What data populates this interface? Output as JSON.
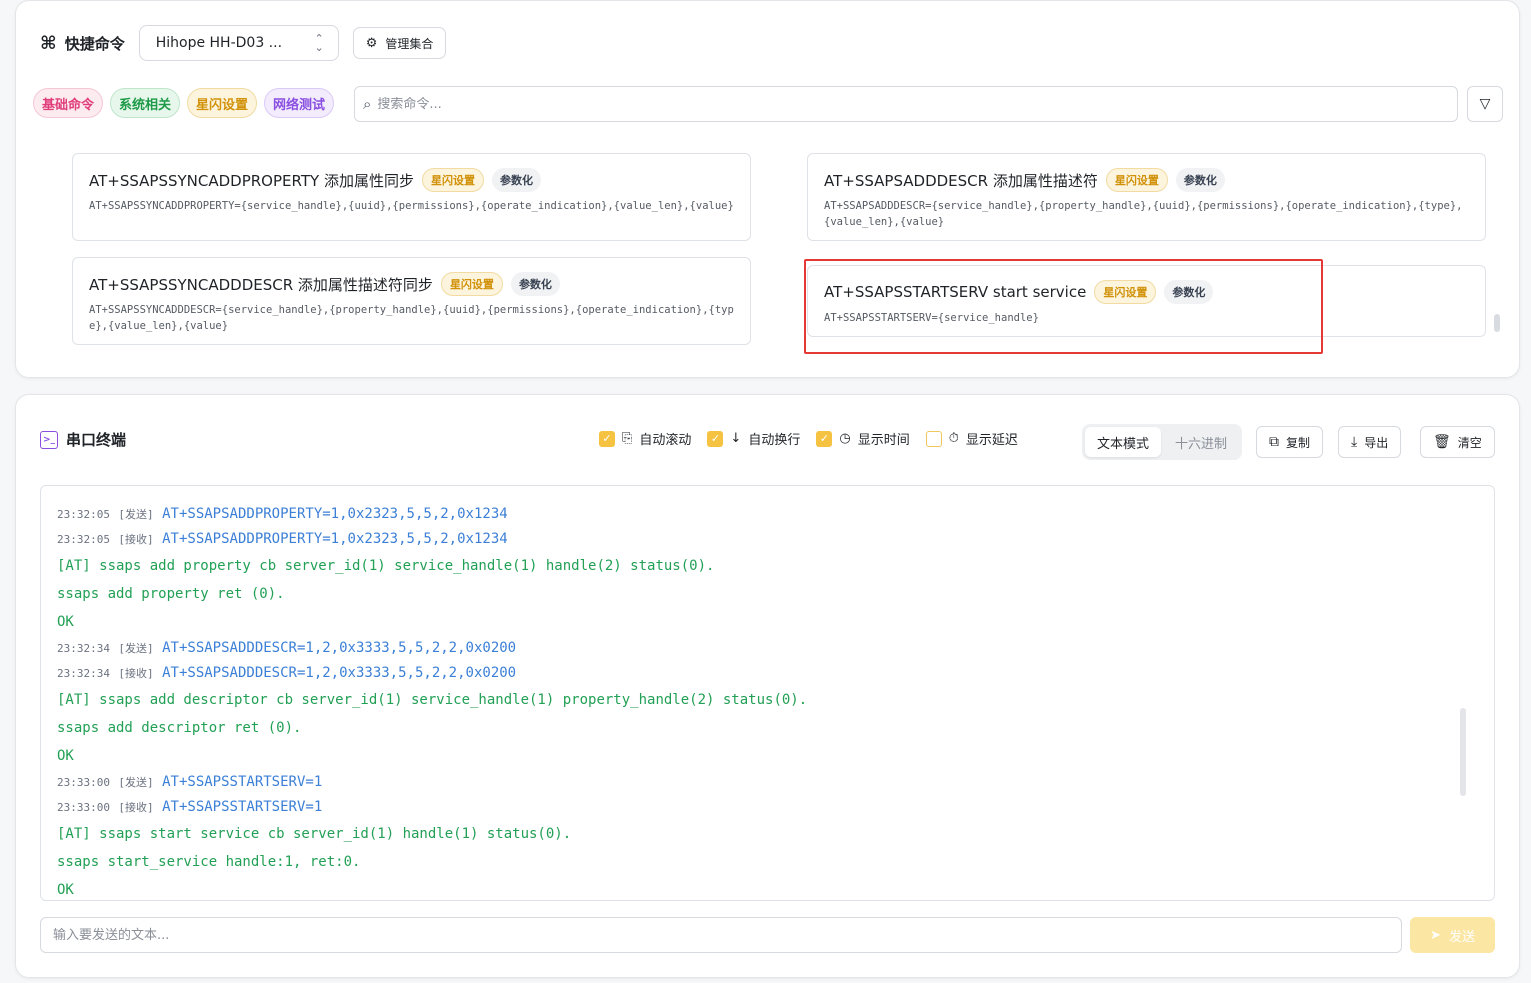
{
  "quick": {
    "title": "快捷命令",
    "cmd_icon": "⌘",
    "device": "Hihope HH-D03 ...",
    "manage_label": "管理集合",
    "tags": [
      "基础命令",
      "系统相关",
      "星闪设置",
      "网络测试"
    ],
    "search_placeholder": "搜索命令...",
    "cards": [
      {
        "name": "AT+SSAPSSYNCADDPROPERTY 添加属性同步",
        "badge": "星闪设置",
        "param": "参数化",
        "syntax": "AT+SSAPSSYNCADDPROPERTY={service_handle},{uuid},{permissions},{operate_indication},{value_len},{value}"
      },
      {
        "name": "AT+SSAPSADDDESCR 添加属性描述符",
        "badge": "星闪设置",
        "param": "参数化",
        "syntax": "AT+SSAPSADDDESCR={service_handle},{property_handle},{uuid},{permissions},{operate_indication},{type},{value_len},{value}"
      },
      {
        "name": "AT+SSAPSSYNCADDDESCR 添加属性描述符同步",
        "badge": "星闪设置",
        "param": "参数化",
        "syntax": "AT+SSAPSSYNCADDDESCR={service_handle},{property_handle},{uuid},{permissions},{operate_indication},{type},{value_len},{value}"
      },
      {
        "name": "AT+SSAPSSTARTSERV start service",
        "badge": "星闪设置",
        "param": "参数化",
        "syntax": "AT+SSAPSSTARTSERV={service_handle}"
      }
    ]
  },
  "terminal": {
    "title": "串口终端",
    "options": [
      {
        "label": "自动滚动",
        "checked": true
      },
      {
        "label": "自动换行",
        "checked": true
      },
      {
        "label": "显示时间",
        "checked": true
      },
      {
        "label": "显示延迟",
        "checked": false
      }
    ],
    "modes": [
      "文本模式",
      "十六进制"
    ],
    "active_mode": "文本模式",
    "copy_label": "复制",
    "export_label": "导出",
    "clear_label": "清空",
    "send_placeholder": "输入要发送的文本...",
    "send_label": "发送",
    "log": [
      {
        "kind": "tx",
        "time": "23:32:05",
        "dir": "[发送]",
        "text": "AT+SSAPSADDPROPERTY=1,0x2323,5,5,2,0x1234"
      },
      {
        "kind": "rx",
        "time": "23:32:05",
        "dir": "[接收]",
        "text": "AT+SSAPSADDPROPERTY=1,0x2323,5,5,2,0x1234"
      },
      {
        "kind": "msg",
        "text": "[AT] ssaps add property cb server_id(1) service_handle(1) handle(2) status(0)."
      },
      {
        "kind": "msg",
        "text": "ssaps add property ret (0)."
      },
      {
        "kind": "msg",
        "text": "OK"
      },
      {
        "kind": "tx",
        "time": "23:32:34",
        "dir": "[发送]",
        "text": "AT+SSAPSADDDESCR=1,2,0x3333,5,5,2,2,0x0200"
      },
      {
        "kind": "rx",
        "time": "23:32:34",
        "dir": "[接收]",
        "text": "AT+SSAPSADDDESCR=1,2,0x3333,5,5,2,2,0x0200"
      },
      {
        "kind": "msg",
        "text": "[AT] ssaps add descriptor cb server_id(1) service_handle(1) property_handle(2) status(0)."
      },
      {
        "kind": "msg",
        "text": "ssaps add descriptor ret (0)."
      },
      {
        "kind": "msg",
        "text": "OK"
      },
      {
        "kind": "tx",
        "time": "23:33:00",
        "dir": "[发送]",
        "text": "AT+SSAPSSTARTSERV=1"
      },
      {
        "kind": "rx",
        "time": "23:33:00",
        "dir": "[接收]",
        "text": "AT+SSAPSSTARTSERV=1"
      },
      {
        "kind": "msg",
        "text": "[AT] ssaps start service cb server_id(1) handle(1) status(0)."
      },
      {
        "kind": "msg",
        "text": "ssaps start_service handle:1, ret:0."
      },
      {
        "kind": "msg",
        "text": "OK"
      }
    ]
  }
}
